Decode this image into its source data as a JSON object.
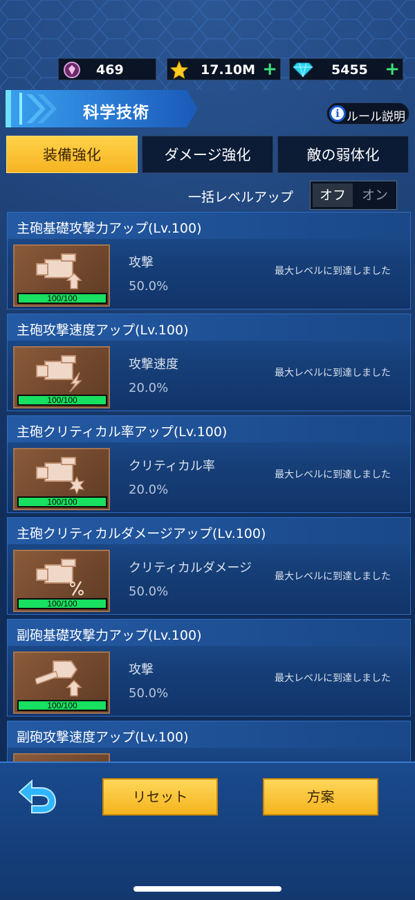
{
  "colors": {
    "accent_gold": "#f6b320",
    "progress_green": "#18e060",
    "plus_green": "#3fe07a",
    "panel_blue": "#163f78"
  },
  "currency": [
    {
      "icon": "medal-gem-icon",
      "value": "469",
      "has_plus": false
    },
    {
      "icon": "star-icon",
      "value": "17.10M",
      "has_plus": true,
      "plus": "+"
    },
    {
      "icon": "diamond-icon",
      "value": "5455",
      "has_plus": true,
      "plus": "+"
    }
  ],
  "header": {
    "title": "科学技術",
    "rules_icon_glyph": "i",
    "rules_label": "ルール説明"
  },
  "tabs": [
    {
      "label": "装備強化",
      "active": true
    },
    {
      "label": "ダメージ強化",
      "active": false
    },
    {
      "label": "敵の弱体化",
      "active": false
    }
  ],
  "bulk_level": {
    "label": "一括レベルアップ",
    "off": "オフ",
    "on": "オン",
    "selected": "オフ"
  },
  "tech_items": [
    {
      "title": "主砲基礎攻撃力アップ(Lv.100)",
      "icon": "main-cannon-attack-up-icon",
      "level": "100/100",
      "level_fraction": 1.0,
      "stat": "攻撃",
      "value": "50.0%",
      "status": "最大レベルに到達しました"
    },
    {
      "title": "主砲攻撃速度アップ(Lv.100)",
      "icon": "main-cannon-speed-up-icon",
      "level": "100/100",
      "level_fraction": 1.0,
      "stat": "攻撃速度",
      "value": "20.0%",
      "status": "最大レベルに到達しました"
    },
    {
      "title": "主砲クリティカル率アップ(Lv.100)",
      "icon": "main-cannon-crit-rate-icon",
      "level": "100/100",
      "level_fraction": 1.0,
      "stat": "クリティカル率",
      "value": "20.0%",
      "status": "最大レベルに到達しました"
    },
    {
      "title": "主砲クリティカルダメージアップ(Lv.100)",
      "icon": "main-cannon-crit-damage-icon",
      "level": "100/100",
      "level_fraction": 1.0,
      "stat": "クリティカルダメージ",
      "value": "50.0%",
      "status": "最大レベルに到達しました"
    },
    {
      "title": "副砲基礎攻撃力アップ(Lv.100)",
      "icon": "sub-cannon-attack-up-icon",
      "level": "100/100",
      "level_fraction": 1.0,
      "stat": "攻撃",
      "value": "50.0%",
      "status": "最大レベルに到達しました"
    },
    {
      "title": "副砲攻撃速度アップ(Lv.100)",
      "icon": "sub-cannon-speed-up-icon",
      "level": "",
      "level_fraction": 1.0,
      "stat": "",
      "value": "",
      "status": ""
    }
  ],
  "footer": {
    "back_icon": "back-arrow-icon",
    "reset_label": "リセット",
    "plan_label": "方案"
  }
}
